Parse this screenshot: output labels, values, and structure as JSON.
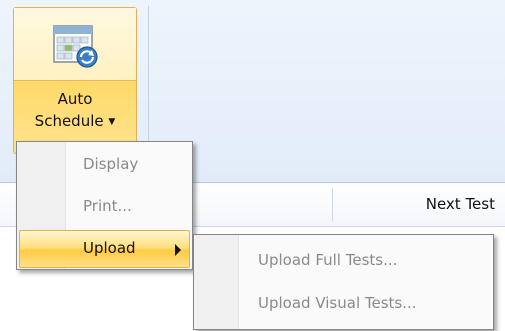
{
  "ribbon": {
    "auto_schedule": {
      "line1": "Auto",
      "line2": "Schedule",
      "icon": "calendar-schedule-icon",
      "state": "pressed"
    }
  },
  "grid": {
    "columns": [
      "Next Test"
    ]
  },
  "menu": {
    "items": [
      {
        "label": "Display",
        "enabled": false
      },
      {
        "label": "Print...",
        "enabled": false
      },
      {
        "label": "Upload",
        "enabled": true,
        "highlighted": true,
        "has_submenu": true
      }
    ]
  },
  "submenu": {
    "items": [
      {
        "label": "Upload Full Tests...",
        "enabled": false
      },
      {
        "label": "Upload Visual Tests...",
        "enabled": false
      }
    ]
  },
  "colors": {
    "highlight": "#ffd96a",
    "highlight_border": "#e1b24e",
    "ribbon_bg": "#e2ecf9",
    "disabled_text": "#8a8a8a"
  }
}
